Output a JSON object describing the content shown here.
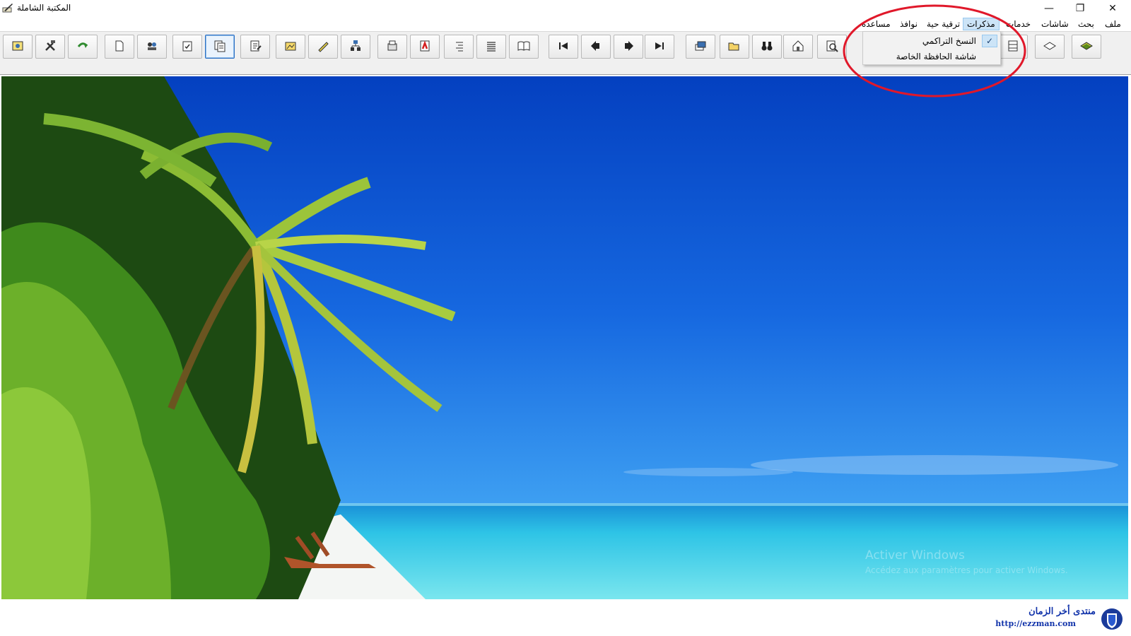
{
  "window": {
    "title": "المكتبة الشاملة",
    "icon": "quill-book-icon"
  },
  "window_controls": {
    "minimize": "—",
    "maximize": "❐",
    "close": "✕"
  },
  "menubar": {
    "items": [
      {
        "label": "ملف"
      },
      {
        "label": "بحث"
      },
      {
        "label": "شاشات"
      },
      {
        "label": "خدمات"
      },
      {
        "label": "مذكرات",
        "active": true
      },
      {
        "label": "ترقية حية"
      },
      {
        "label": "نوافذ"
      },
      {
        "label": "مساعدة"
      }
    ]
  },
  "dropdown": {
    "parent": "مذكرات",
    "items": [
      {
        "label": "النسخ التراكمي",
        "checked": true
      },
      {
        "label": "شاشة الحافظة الخاصة",
        "checked": false
      }
    ]
  },
  "toolbar": {
    "buttons": [
      {
        "icon": "gear-settings-icon"
      },
      {
        "icon": "tools-icon"
      },
      {
        "icon": "refresh-arrow-icon"
      },
      {
        "icon": "new-page-icon"
      },
      {
        "icon": "link-users-icon"
      },
      {
        "icon": "checklist-icon"
      },
      {
        "icon": "copy-pages-icon",
        "selected": true
      },
      {
        "icon": "edit-document-icon"
      },
      {
        "icon": "image-folder-icon"
      },
      {
        "icon": "pencil-icon"
      },
      {
        "icon": "tree-structure-icon"
      },
      {
        "icon": "print-copy-icon"
      },
      {
        "icon": "pdf-export-icon"
      },
      {
        "icon": "indent-list-icon"
      },
      {
        "icon": "align-lines-icon"
      },
      {
        "icon": "open-book-icon"
      },
      {
        "icon": "first-page-icon"
      },
      {
        "icon": "previous-page-icon"
      },
      {
        "icon": "next-page-icon"
      },
      {
        "icon": "last-page-icon"
      },
      {
        "icon": "windows-stack-icon"
      },
      {
        "icon": "open-folder-icon"
      },
      {
        "icon": "binoculars-icon"
      },
      {
        "icon": "bookmark-house-icon"
      },
      {
        "icon": "magnify-document-icon"
      },
      {
        "icon": "display-icon"
      },
      {
        "icon": "bookshelf-icon"
      },
      {
        "icon": "closed-book-outline-icon"
      },
      {
        "icon": "green-book-icon"
      }
    ]
  },
  "main": {
    "background": "tropical-beach-wallpaper",
    "watermark_title": "Activer Windows",
    "watermark_sub": "Accédez aux paramètres pour activer Windows."
  },
  "forum_watermark": {
    "name": "منتدى أخر الزمان",
    "url": "http://ezzman.com"
  },
  "colors": {
    "sky_top": "#0848c8",
    "sky_bottom": "#2a8cf0",
    "sea": "#2ec8e8",
    "menu_highlight": "#cce4f7",
    "annotation": "#e0182a",
    "forum_text": "#1133aa"
  }
}
